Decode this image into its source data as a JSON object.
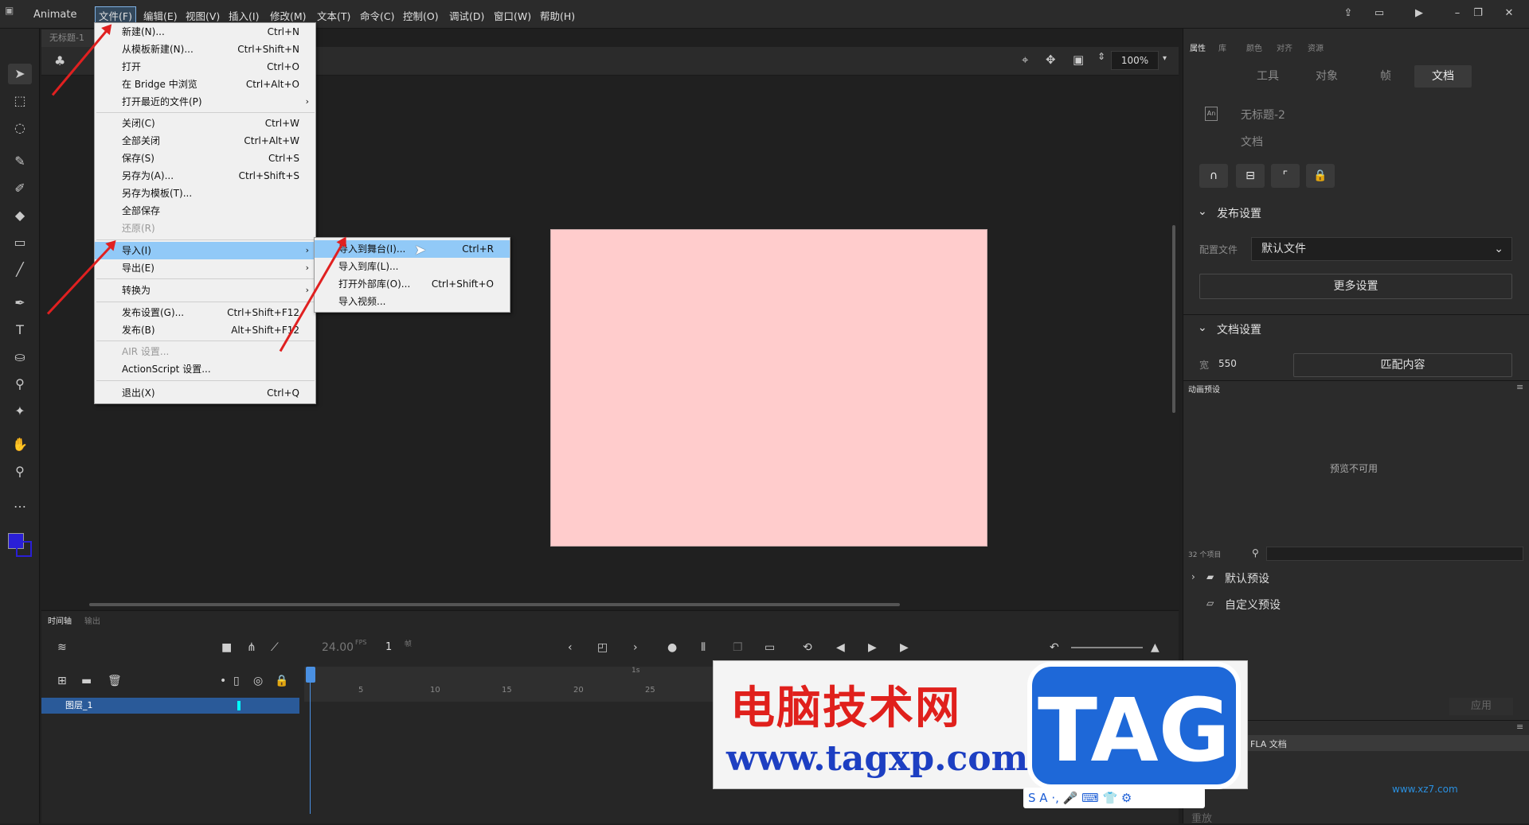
{
  "menubar": {
    "app_name": "Animate",
    "items": [
      "文件(F)",
      "编辑(E)",
      "视图(V)",
      "插入(I)",
      "修改(M)",
      "文本(T)",
      "命令(C)",
      "控制(O)",
      "调试(D)",
      "窗口(W)",
      "帮助(H)"
    ]
  },
  "document_tab": "无标题-1",
  "file_menu": [
    {
      "label": "新建(N)...",
      "shortcut": "Ctrl+N"
    },
    {
      "label": "从模板新建(N)...",
      "shortcut": "Ctrl+Shift+N"
    },
    {
      "label": "打开",
      "shortcut": "Ctrl+O"
    },
    {
      "label": "在 Bridge 中浏览",
      "shortcut": "Ctrl+Alt+O"
    },
    {
      "label": "打开最近的文件(P)",
      "shortcut": ""
    },
    {
      "label": "关闭(C)",
      "shortcut": "Ctrl+W"
    },
    {
      "label": "全部关闭",
      "shortcut": "Ctrl+Alt+W"
    },
    {
      "label": "保存(S)",
      "shortcut": "Ctrl+S"
    },
    {
      "label": "另存为(A)...",
      "shortcut": "Ctrl+Shift+S"
    },
    {
      "label": "另存为模板(T)...",
      "shortcut": ""
    },
    {
      "label": "全部保存",
      "shortcut": ""
    },
    {
      "label": "还原(R)",
      "shortcut": ""
    },
    {
      "label": "导入(I)",
      "shortcut": ""
    },
    {
      "label": "导出(E)",
      "shortcut": ""
    },
    {
      "label": "转换为",
      "shortcut": ""
    },
    {
      "label": "发布设置(G)...",
      "shortcut": "Ctrl+Shift+F12"
    },
    {
      "label": "发布(B)",
      "shortcut": "Alt+Shift+F12"
    },
    {
      "label": "AIR 设置...",
      "shortcut": ""
    },
    {
      "label": "ActionScript 设置...",
      "shortcut": ""
    },
    {
      "label": "退出(X)",
      "shortcut": "Ctrl+Q"
    }
  ],
  "import_menu": [
    {
      "label": "导入到舞台(I)...",
      "shortcut": "Ctrl+R"
    },
    {
      "label": "导入到库(L)...",
      "shortcut": ""
    },
    {
      "label": "打开外部库(O)...",
      "shortcut": "Ctrl+Shift+O"
    },
    {
      "label": "导入视频...",
      "shortcut": ""
    }
  ],
  "edit_bar": {
    "zoom": "100%"
  },
  "right_panel": {
    "tabs": [
      "属性",
      "库",
      "颜色",
      "对齐",
      "资源"
    ],
    "subtabs": [
      "工具",
      "对象",
      "帧",
      "文档"
    ],
    "doc_name": "无标题-2",
    "doc_type": "文档",
    "publish_section": "发布设置",
    "profile_label": "配置文件",
    "profile_value": "默认文件",
    "more_settings": "更多设置",
    "doc_section": "文档设置",
    "width_label": "宽",
    "width_value": "550",
    "match_content": "匹配内容",
    "anim_preset_title": "动画预设",
    "preview_unavailable": "预览不可用",
    "item_count": "32 个项目",
    "folders": [
      "默认预设",
      "自定义预设"
    ],
    "apply_btn": "应用",
    "fla_doc": "FLA 文档",
    "bottom_label": "重放"
  },
  "timeline": {
    "tabs": [
      "时间轴",
      "输出"
    ],
    "fps": "24.00",
    "fps_unit": "FPS",
    "frame": "1",
    "frame_unit": "帧",
    "layer_name": "图层_1",
    "sec_marker": "1s",
    "frame_numbers": [
      "5",
      "10",
      "15",
      "20",
      "25"
    ]
  },
  "watermark": {
    "cn": "电脑技术网",
    "url": "www.tagxp.com",
    "tag": "TAG",
    "corner": "www.xz7.com"
  },
  "colors": {
    "stage": "#ffcccc",
    "highlight": "#91c9f7",
    "arrow": "#e02020",
    "fill_swatch": "#2a1fd6"
  }
}
